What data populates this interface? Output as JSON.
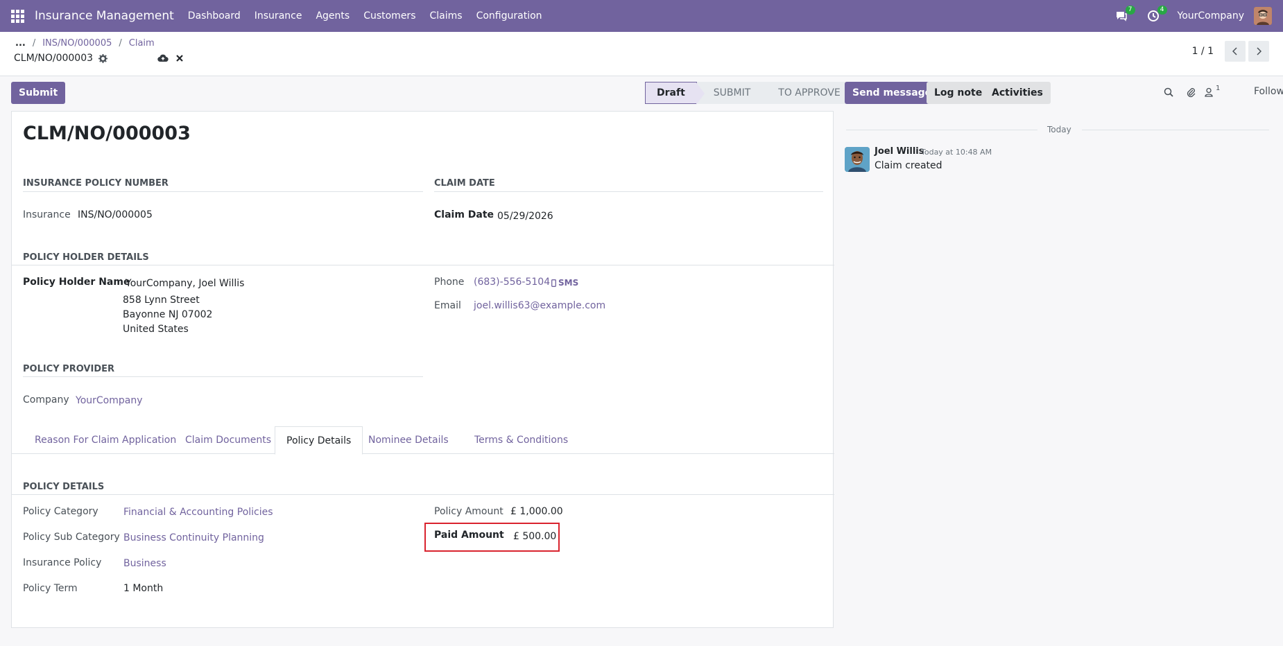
{
  "navbar": {
    "app_name": "Insurance Management",
    "menu": [
      "Dashboard",
      "Insurance",
      "Agents",
      "Customers",
      "Claims",
      "Configuration"
    ],
    "messages_count": "7",
    "activities_count": "4",
    "company": "YourCompany"
  },
  "breadcrumb": {
    "ellipsis": "...",
    "items": [
      "INS/NO/000005",
      "Claim"
    ],
    "current": "CLM/NO/000003"
  },
  "pager": {
    "value": "1 / 1"
  },
  "actions": {
    "submit": "Submit"
  },
  "statusbar": {
    "stages": [
      "Draft",
      "SUBMIT",
      "TO APPROVE"
    ],
    "active": "Draft"
  },
  "form": {
    "title": "CLM/NO/000003",
    "sections": {
      "insurance_policy_number": "INSURANCE POLICY NUMBER",
      "claim_date": "CLAIM DATE",
      "policy_holder_details": "POLICY HOLDER DETAILS",
      "policy_provider": "POLICY PROVIDER",
      "policy_details": "POLICY DETAILS"
    },
    "fields": {
      "insurance_label": "Insurance",
      "insurance_value": "INS/NO/000005",
      "claim_date_label": "Claim Date",
      "claim_date_value": "05/29/2026",
      "holder_label": "Policy Holder Name",
      "holder_name": "YourCompany, Joel Willis",
      "address_1": "858 Lynn Street",
      "address_2": "Bayonne NJ 07002",
      "address_3": "United States",
      "phone_label": "Phone",
      "phone_value": "(683)-556-5104",
      "sms_label": "SMS",
      "email_label": "Email",
      "email_value": "joel.willis63@example.com",
      "company_label": "Company",
      "company_value": "YourCompany",
      "category_label": "Policy Category",
      "category_value": "Financial & Accounting Policies",
      "sub_category_label": "Policy Sub Category",
      "sub_category_value": "Business Continuity Planning",
      "insurance_policy_label": "Insurance Policy",
      "insurance_policy_value": "Business",
      "term_label": "Policy Term",
      "term_value": "1 Month",
      "amount_label": "Policy Amount",
      "amount_value": "£ 1,000.00",
      "paid_label": "Paid Amount",
      "paid_value": "£ 500.00"
    },
    "tabs": [
      "Reason For Claim Application",
      "Claim Documents",
      "Policy Details",
      "Nominee Details",
      "Terms & Conditions"
    ],
    "active_tab": "Policy Details"
  },
  "chatter": {
    "send_message": "Send message",
    "log_note": "Log note",
    "activities": "Activities",
    "followers_count": "1",
    "follow": "Follow",
    "today": "Today",
    "message": {
      "author": "Joel Willis",
      "date": "Today at 10:48 AM",
      "body": "Claim created"
    }
  },
  "colors": {
    "brand": "#71639e",
    "highlight": "#d9232e",
    "badge": "#28a745"
  }
}
